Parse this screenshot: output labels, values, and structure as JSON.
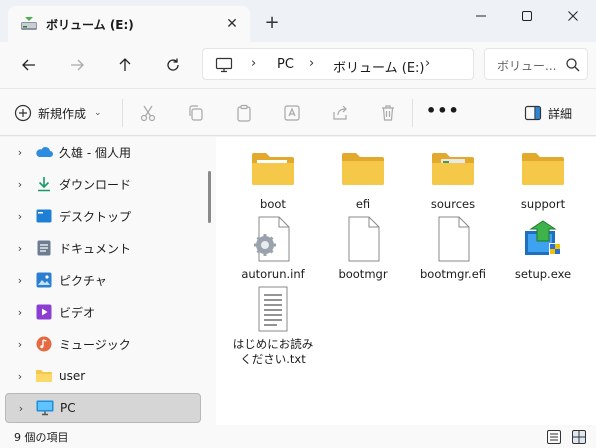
{
  "tab": {
    "title": "ボリューム (E:)",
    "close": "✕",
    "new_tab": "+"
  },
  "window_controls": {
    "minimize": "minimize-icon",
    "maximize": "maximize-icon",
    "close": "close-icon"
  },
  "address": {
    "segments": [
      "PC",
      "ボリューム (E:)"
    ],
    "separator": "›"
  },
  "search": {
    "placeholder": "ボリュー..."
  },
  "commands": {
    "new_label": "新規作成",
    "new_chevron": "⌄",
    "more_label": "•••",
    "details_label": "詳細"
  },
  "sidebar": {
    "items": [
      {
        "label": "久雄 - 個人用",
        "icon": "onedrive-icon"
      },
      {
        "label": "ダウンロード",
        "icon": "download-icon"
      },
      {
        "label": "デスクトップ",
        "icon": "desktop-icon"
      },
      {
        "label": "ドキュメント",
        "icon": "document-icon"
      },
      {
        "label": "ピクチャ",
        "icon": "pictures-icon"
      },
      {
        "label": "ビデオ",
        "icon": "video-icon"
      },
      {
        "label": "ミュージック",
        "icon": "music-icon"
      },
      {
        "label": "user",
        "icon": "folder-icon"
      },
      {
        "label": "PC",
        "icon": "pc-icon"
      }
    ],
    "chevron": "›"
  },
  "files": [
    {
      "name": "boot",
      "type": "folder"
    },
    {
      "name": "efi",
      "type": "folder"
    },
    {
      "name": "sources",
      "type": "folder"
    },
    {
      "name": "support",
      "type": "folder"
    },
    {
      "name": "autorun.inf",
      "type": "settings-file"
    },
    {
      "name": "bootmgr",
      "type": "file"
    },
    {
      "name": "bootmgr.efi",
      "type": "file"
    },
    {
      "name": "setup.exe",
      "type": "installer"
    },
    {
      "name": "はじめにお読みください.txt",
      "type": "text-file"
    }
  ],
  "status": {
    "item_count": "9 個の項目"
  },
  "colors": {
    "folder": "#f5c84a",
    "folder_dark": "#e2a92d",
    "accent": "#0067c0"
  }
}
